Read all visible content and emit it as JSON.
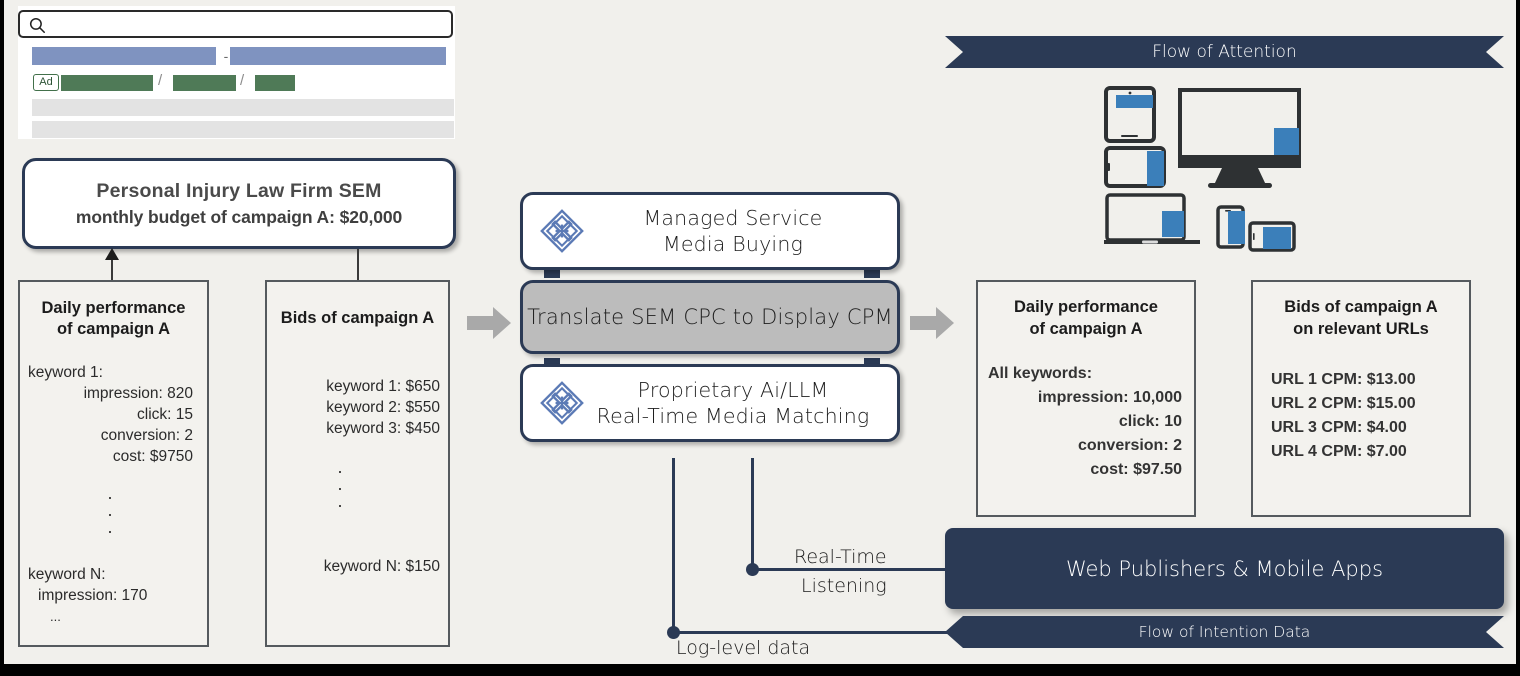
{
  "search_mock": {
    "icon": "search-icon",
    "ad_label": "Ad",
    "separator_dash": "-",
    "slash": "/"
  },
  "title_card": {
    "line1": "Personal Injury Law Firm SEM",
    "line2": "monthly budget of campaign A: $20,000"
  },
  "left_boxes": [
    {
      "title_line1": "Daily performance",
      "title_line2": "of campaign A",
      "lines": [
        "keyword 1:",
        "impression: 820",
        "click: 15",
        "conversion: 2",
        "cost: $9750",
        "keyword N:",
        "impression: 170",
        "..."
      ]
    },
    {
      "title_line1": "Bids of campaign A",
      "title_line2": "",
      "lines": [
        "keyword 1: $650",
        "keyword 2: $550",
        "keyword 3: $450",
        "keyword N: $150"
      ]
    }
  ],
  "center_stack": {
    "top": {
      "line1": "Managed Service",
      "line2": "Media Buying",
      "icon": "company-logo-icon"
    },
    "middle": {
      "label": "Translate SEM CPC to Display CPM"
    },
    "bottom": {
      "line1": "Proprietary Ai/LLM",
      "line2": "Real-Time Media Matching",
      "icon": "company-logo-icon"
    }
  },
  "right_boxes": [
    {
      "title_line1": "Daily performance",
      "title_line2": "of campaign A",
      "lines": [
        "All keywords:",
        "impression:  10,000",
        "click: 10",
        "conversion:  2",
        "cost: $97.50"
      ]
    },
    {
      "title_line1": "Bids of campaign A",
      "title_line2": "on relevant URLs",
      "lines": [
        "URL 1 CPM: $13.00",
        "URL 2 CPM: $15.00",
        "URL 3 CPM: $4.00",
        "URL 4 CPM: $7.00"
      ]
    }
  ],
  "banners": {
    "attention": "Flow of Attention",
    "publishers": "Web Publishers & Mobile Apps",
    "intention": "Flow of Intention Data"
  },
  "connector_labels": {
    "realtime_line1": "Real-Time",
    "realtime_line2": "Listening",
    "log_level": "Log-level data"
  },
  "colors": {
    "navy": "#2b3a55",
    "device_blue": "#3b7fba",
    "link_blue": "#7f93c0",
    "ad_green": "#4f7a57",
    "process_gray": "#bcbcbc",
    "background": "#f1f0ec"
  }
}
